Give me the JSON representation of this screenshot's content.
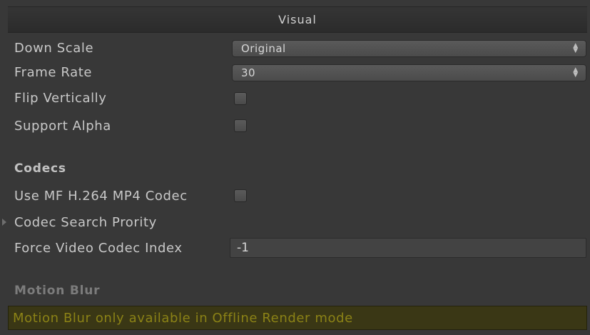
{
  "header": {
    "title": "Visual"
  },
  "fields": {
    "down_scale": {
      "label": "Down Scale",
      "value": "Original"
    },
    "frame_rate": {
      "label": "Frame Rate",
      "value": "30"
    },
    "flip_vertically": {
      "label": "Flip Vertically",
      "checked": false
    },
    "support_alpha": {
      "label": "Support Alpha",
      "checked": false
    }
  },
  "codecs": {
    "title": "Codecs",
    "use_mf": {
      "label": "Use MF H.264 MP4 Codec",
      "checked": false
    },
    "search_priority": {
      "label": "Codec Search Prority"
    },
    "force_index": {
      "label": "Force Video Codec Index",
      "value": "-1"
    }
  },
  "motion_blur": {
    "title": "Motion Blur",
    "warning": "Motion Blur only available in Offline Render mode"
  },
  "icons": {
    "dropdown_arrows": "up-down-arrows-icon",
    "foldout": "foldout-triangle-icon"
  },
  "colors": {
    "background": "#383838",
    "warning_bg": "#3a3715",
    "warning_text": "#8b8216"
  }
}
